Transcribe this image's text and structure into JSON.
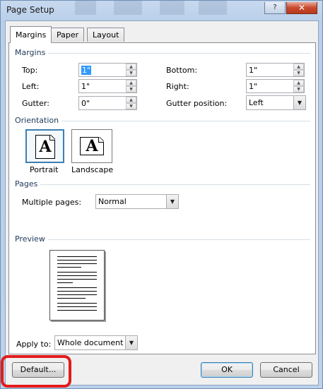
{
  "window": {
    "title": "Page Setup",
    "help_label": "?",
    "close_label": "✕"
  },
  "tabs": [
    {
      "label": "Margins",
      "active": true
    },
    {
      "label": "Paper",
      "active": false
    },
    {
      "label": "Layout",
      "active": false
    }
  ],
  "margins": {
    "section_label": "Margins",
    "top": {
      "label": "Top:",
      "value": "1\""
    },
    "bottom": {
      "label": "Bottom:",
      "value": "1\""
    },
    "left": {
      "label": "Left:",
      "value": "1\""
    },
    "right": {
      "label": "Right:",
      "value": "1\""
    },
    "gutter": {
      "label": "Gutter:",
      "value": "0\""
    },
    "gutter_position": {
      "label": "Gutter position:",
      "value": "Left"
    }
  },
  "orientation": {
    "section_label": "Orientation",
    "portrait_label": "Portrait",
    "landscape_label": "Landscape",
    "icon_glyph": "A",
    "selected": "portrait"
  },
  "pages": {
    "section_label": "Pages",
    "multiple_pages_label": "Multiple pages:",
    "multiple_pages_value": "Normal"
  },
  "preview": {
    "section_label": "Preview"
  },
  "apply_to": {
    "label": "Apply to:",
    "value": "Whole document"
  },
  "buttons": {
    "default_label": "Default...",
    "ok_label": "OK",
    "cancel_label": "Cancel"
  },
  "colors": {
    "highlight_ring": "#e31b1b",
    "focus_border": "#3c7fb1"
  }
}
